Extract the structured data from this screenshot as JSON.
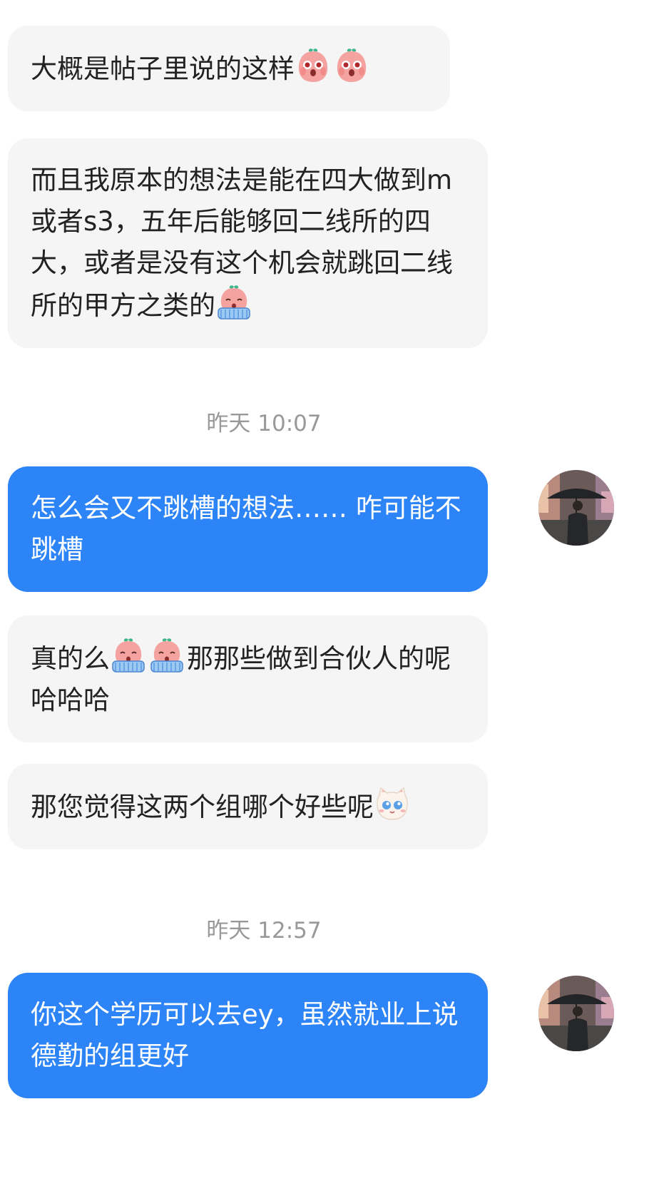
{
  "messages": [
    {
      "side": "incoming",
      "text_before": "大概是帖子里说的这样",
      "emojis": [
        "peach-shocked-emoji",
        "peach-shocked-emoji"
      ],
      "text_after": ""
    },
    {
      "side": "incoming",
      "text_before": "而且我原本的想法是能在四大做到m或者s3，五年后能够回二线所的四大，或者是没有这个机会就跳回二线所的甲方之类的",
      "emojis": [
        "peach-crying-emoji"
      ],
      "text_after": ""
    },
    {
      "side": "outgoing",
      "text": "怎么会又不跳槽的想法…… 咋可能不跳槽"
    },
    {
      "side": "incoming",
      "text_before": "真的么",
      "emojis": [
        "peach-crying-emoji",
        "peach-crying-emoji"
      ],
      "text_after": "那那些做到合伙人的呢哈哈哈"
    },
    {
      "side": "incoming",
      "text_before": "那您觉得这两个组哪个好些呢",
      "emojis": [
        "cat-teary-emoji"
      ],
      "text_after": ""
    },
    {
      "side": "outgoing",
      "text": "你这个学历可以去ey，虽然就业上说德勤的组更好"
    }
  ],
  "timestamps": [
    "昨天 10:07",
    "昨天 12:57"
  ],
  "colors": {
    "incoming_bubble": "#f5f5f5",
    "outgoing_bubble": "#2d84f7",
    "timestamp_text": "#999999"
  }
}
